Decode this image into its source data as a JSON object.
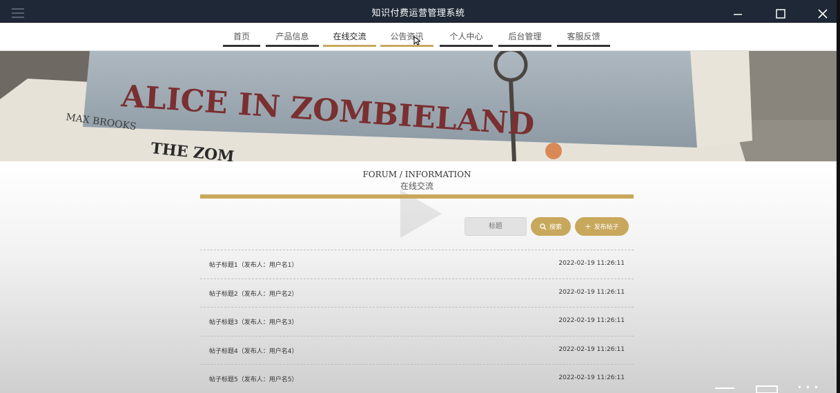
{
  "window": {
    "title": "知识付费运营管理系统"
  },
  "nav": {
    "items": [
      {
        "label": "首页"
      },
      {
        "label": "产品信息"
      },
      {
        "label": "在线交流",
        "active": true
      },
      {
        "label": "公告资讯"
      },
      {
        "label": "个人中心"
      },
      {
        "label": "后台管理"
      },
      {
        "label": "客服反馈"
      }
    ]
  },
  "banner": {
    "book_title": "ALICE IN ZOMBIELAND",
    "author": "MAX BROOKS",
    "book2_partial": "THE ZOM"
  },
  "section": {
    "title_en": "FORUM / INFORMATION",
    "title_cn": "在线交流"
  },
  "search": {
    "placeholder": "标题",
    "search_label": "搜索",
    "post_label": "发布帖子"
  },
  "posts": [
    {
      "title": "帖子标题1（发布人：用户名1）",
      "date": "2022-02-19 11:26:11"
    },
    {
      "title": "帖子标题2（发布人：用户名2）",
      "date": "2022-02-19 11:26:11"
    },
    {
      "title": "帖子标题3（发布人：用户名3）",
      "date": "2022-02-19 11:26:11"
    },
    {
      "title": "帖子标题4（发布人：用户名4）",
      "date": "2022-02-19 11:26:11"
    },
    {
      "title": "帖子标题5（发布人：用户名5）",
      "date": "2022-02-19 11:26:11"
    }
  ],
  "colors": {
    "accent": "#c8a85c",
    "titlebar": "#1f2836"
  }
}
